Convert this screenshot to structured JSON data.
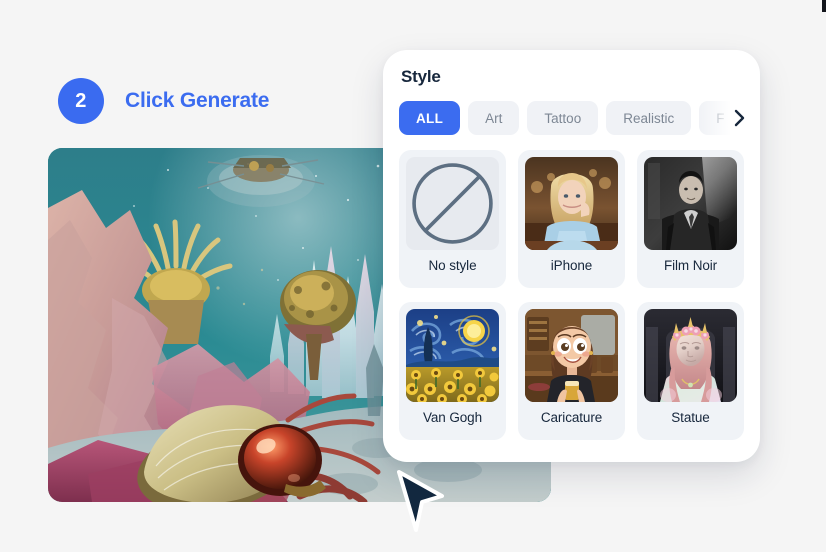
{
  "page": {
    "background_color": "#f5f5f5"
  },
  "step": {
    "number": "2",
    "title": "Click Generate",
    "badge_color": "#3a6bf0",
    "title_color": "#3b6cf0"
  },
  "generated_image": {
    "alt": "Surreal underwater alien landscape with pink coral rock formations, teal water, crystal spires and a large iridescent beetle creature in the foreground"
  },
  "style_panel": {
    "title": "Style",
    "accent_color": "#3b6cf0",
    "card_background": "#f0f3f7",
    "filters": [
      {
        "label": "ALL",
        "active": true
      },
      {
        "label": "Art",
        "active": false
      },
      {
        "label": "Tattoo",
        "active": false
      },
      {
        "label": "Realistic",
        "active": false
      },
      {
        "label": "F",
        "active": false
      }
    ],
    "next_icon": "chevron-right-icon",
    "styles": [
      {
        "label": "No style",
        "thumb": "no-style-icon"
      },
      {
        "label": "iPhone",
        "thumb": "iphone-thumb"
      },
      {
        "label": "Film Noir",
        "thumb": "film-noir-thumb"
      },
      {
        "label": "Van Gogh",
        "thumb": "van-gogh-thumb"
      },
      {
        "label": "Caricature",
        "thumb": "caricature-thumb"
      },
      {
        "label": "Statue",
        "thumb": "statue-thumb"
      }
    ]
  },
  "cursor": {
    "icon": "arrow-pointer-icon",
    "fill": "#12283f"
  }
}
